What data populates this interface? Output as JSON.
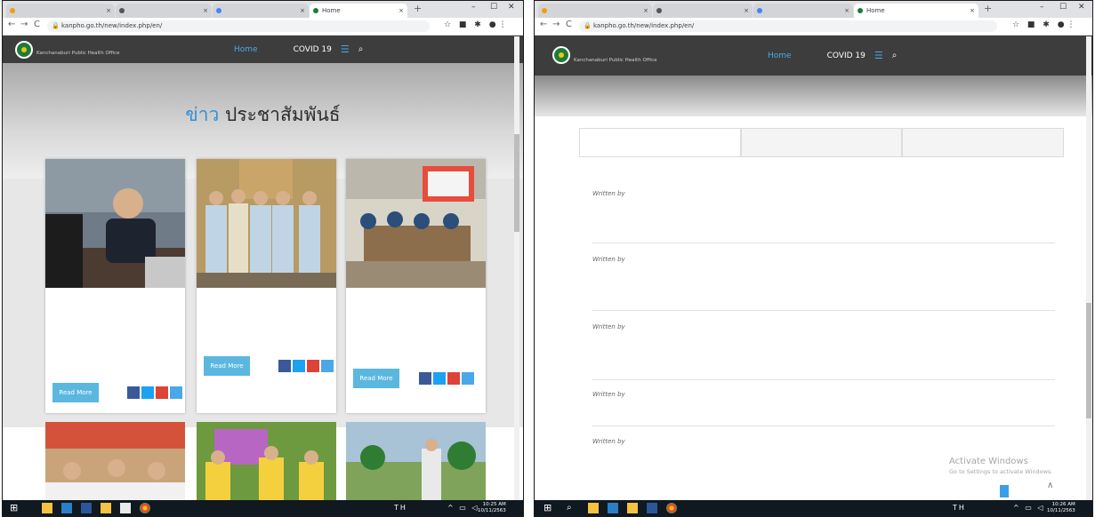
{
  "colors": {
    "accent": "#2f8fd8",
    "header_bg": "#3d3d3d",
    "button": "#5bb7e0",
    "taskbar": "#101820"
  },
  "browser": {
    "window_controls": {
      "min": "–",
      "max": "☐",
      "close": "✕"
    },
    "new_tab": "+",
    "nav": {
      "back": "←",
      "forward": "→",
      "reload": "C"
    },
    "url": "kanpho.go.th/new/index.php/en/",
    "lock_icon": "lock-icon"
  },
  "left": {
    "tabs": [
      {
        "label": "",
        "close": "×"
      },
      {
        "label": "",
        "close": "×"
      },
      {
        "label": "",
        "close": "×"
      },
      {
        "label": "Home",
        "close": "×"
      }
    ]
  },
  "right": {
    "tabs": [
      {
        "label": "",
        "close": "×"
      },
      {
        "label": "",
        "close": "×"
      },
      {
        "label": "",
        "close": "×"
      },
      {
        "label": "Home",
        "close": "×"
      }
    ]
  },
  "site": {
    "logo_th": "",
    "logo_en": "Kanchanaburi Public Health Office",
    "menu": [
      "Home",
      "",
      "",
      "",
      "COVID 19"
    ],
    "section_title_blue": "ข่าว",
    "section_title_rest": "ประชาสัมพันธ์",
    "read_more": "Read More"
  },
  "cards": [
    {
      "title": "",
      "author": ""
    },
    {
      "title": "",
      "author": ""
    },
    {
      "title": "",
      "author": ""
    }
  ],
  "right_tabs": [
    "",
    "",
    ""
  ],
  "news": [
    {
      "text": "",
      "written_by": "Written by",
      "author": ""
    },
    {
      "text": "",
      "written_by": "Written by",
      "author": ""
    },
    {
      "text": "",
      "written_by": "Written by",
      "author": ""
    },
    {
      "text": "",
      "written_by": "Written by",
      "author": ""
    },
    {
      "text": "",
      "written_by": "Written by",
      "author": ""
    }
  ],
  "activate": {
    "title": "Activate Windows",
    "sub": "Go to Settings to activate Windows."
  },
  "taskbar": {
    "left": {
      "time": "10:25 AM",
      "date": "10/11/2563",
      "lang": "TH"
    },
    "right": {
      "time": "10:26 AM",
      "date": "10/11/2563",
      "lang": "TH"
    }
  }
}
